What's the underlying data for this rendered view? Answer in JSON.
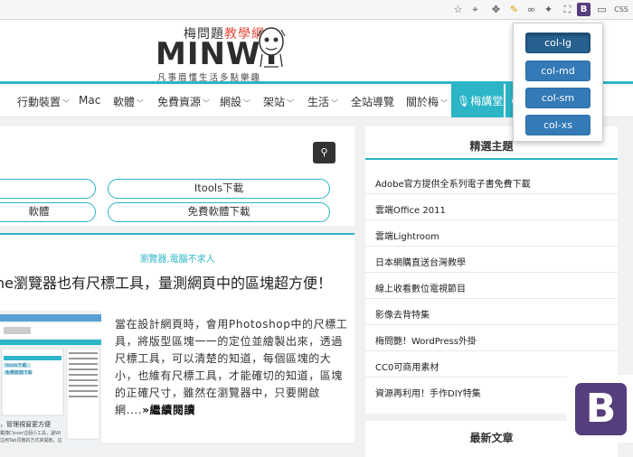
{
  "toolbar": {
    "icons": [
      "star-icon",
      "crosshair-icon",
      "move-icon",
      "pencil-icon",
      "glasses-icon",
      "puzzle-icon",
      "block-icon",
      "crop-icon",
      "bootstrap-icon",
      "window-icon",
      "css-icon"
    ],
    "bootstrap_letter": "B",
    "css_label": "CSS"
  },
  "header": {
    "logo_top_prefix": "梅問題",
    "logo_top_highlight": "教學網",
    "logo_main": "MINWT",
    "logo_sub": "凡事眉懂生活多點樂趣"
  },
  "nav": {
    "items": [
      "行動裝置",
      "Mac",
      "軟體",
      "免費資源",
      "網設",
      "架站",
      "生活",
      "全站導覽",
      "關於梅"
    ],
    "active": "梅講堂"
  },
  "search": {
    "button_icon": "search-icon",
    "links": [
      "",
      "Itools下載",
      "軟體",
      "免費軟體下載"
    ]
  },
  "article": {
    "category": "瀏覽器,電腦不求人",
    "title": "ne瀏覽器也有尺標工具，量測網頁中的區塊超方便！",
    "excerpt": "當在設計網頁時，會用Photoshop中的尺標工具，將版型區塊一一的定位並繪製出來，透過尺標工具，可以清楚的知道，每個區塊的大小，也維有尺標工具，才能確切的知道，區塊的正確尺寸，雖然在瀏覽器中，只要開啟網....",
    "more_label": "»繼續閱讀",
    "thumb_text": [
      "Itools下載",
      "免費軟體下載",
      "，管理視窗更方便",
      "覆捷Clover這個小工具，讓Wi",
      "這用Tab頁籤的方式來開啟，這"
    ]
  },
  "sidebar": {
    "title": "精選主題",
    "items": [
      "Adobe官方提供全系列電子書免費下載",
      "雲端Office 2011",
      "雲端Lightroom",
      "日本網購直送台灣教學",
      "線上收看數位電視節目",
      "影像去背特集",
      "梅問艷！WordPress外掛",
      "CC0可商用素材",
      "資源再利用！手作DIY特集"
    ],
    "next_title": "最新文章"
  },
  "popup": {
    "buttons": [
      "col-lg",
      "col-md",
      "col-sm",
      "col-xs"
    ],
    "active": "col-lg"
  },
  "colors": {
    "accent": "#2bb5c6",
    "bootstrap": "#563d7c",
    "button_blue": "#337ab7"
  }
}
